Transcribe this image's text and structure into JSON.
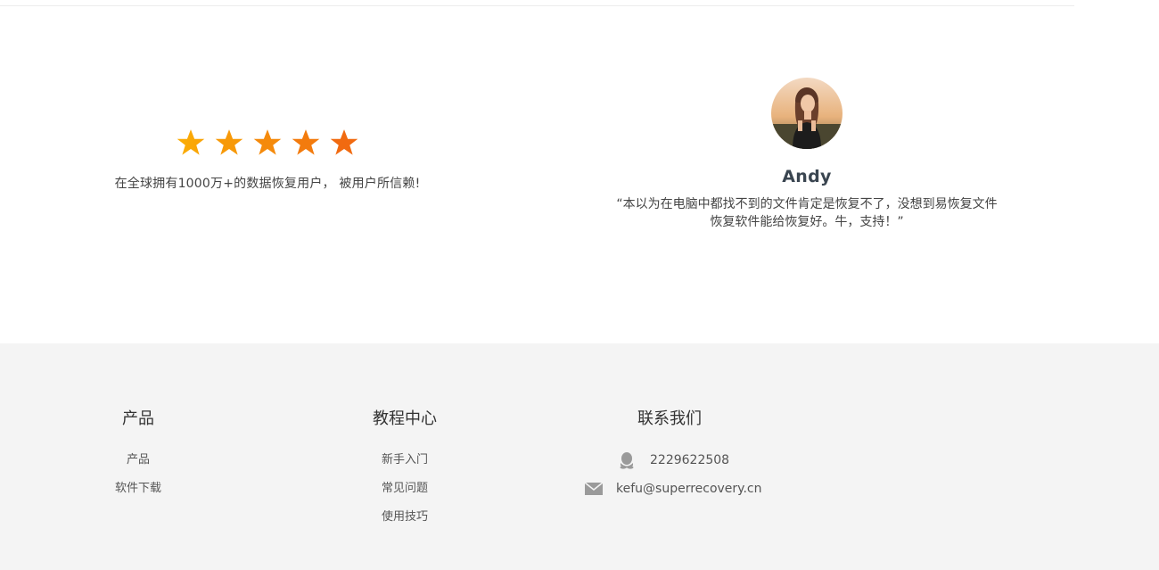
{
  "rating": {
    "stars": 5,
    "text": "在全球拥有1000万+的数据恢复用户， 被用户所信赖!"
  },
  "testimonial": {
    "name": "Andy",
    "text": "“本以为在电脑中都找不到的文件肯定是恢复不了，没想到易恢复文件恢复软件能给恢复好。牛，支持！”"
  },
  "footer": {
    "products": {
      "title": "产品",
      "links": [
        "产品",
        "软件下载"
      ]
    },
    "tutorials": {
      "title": "教程中心",
      "links": [
        "新手入门",
        "常见问题",
        "使用技巧"
      ]
    },
    "contact": {
      "title": "联系我们",
      "qq": "2229622508",
      "email": "kefu@superrecovery.cn"
    }
  },
  "colors": {
    "star_start": "#f9a602",
    "star_end": "#f26a10",
    "footer_bg": "#f4f4f4"
  },
  "icons": [
    "star-icon",
    "qq-icon",
    "mail-icon"
  ]
}
